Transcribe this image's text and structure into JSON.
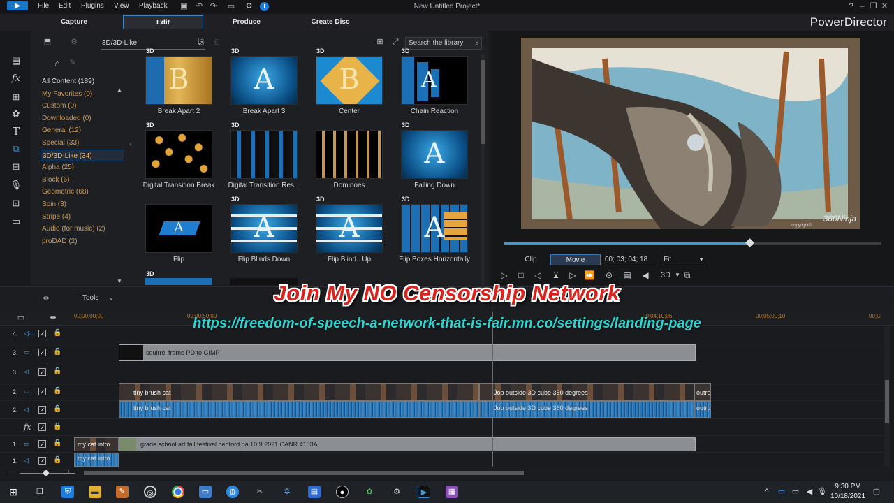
{
  "window": {
    "title": "New Untitled Project*",
    "brand": "PowerDirector"
  },
  "menu": [
    "File",
    "Edit",
    "Plugins",
    "View",
    "Playback"
  ],
  "modes": [
    "Capture",
    "Edit",
    "Produce",
    "Create Disc"
  ],
  "library": {
    "category_select": "3D/3D-Like",
    "search_placeholder": "Search the library",
    "categories": [
      "All Content  (189)",
      "My Favorites  (0)",
      "Custom  (0)",
      "Downloaded  (0)",
      "General  (12)",
      "Special  (33)",
      "3D/3D-Like  (34)",
      "Alpha  (25)",
      "Block  (6)",
      "Geometric  (68)",
      "Spin  (3)",
      "Stripe  (4)",
      "Audio (for music)  (2)",
      "proDAD  (2)"
    ],
    "items": [
      {
        "label": "Break Apart 2",
        "badge": "3D",
        "glyph": "B"
      },
      {
        "label": "Break Apart 3",
        "badge": "3D",
        "glyph": "A"
      },
      {
        "label": "Center",
        "badge": "3D",
        "glyph": "B"
      },
      {
        "label": "Chain Reaction",
        "badge": "3D",
        "glyph": "A"
      },
      {
        "label": "Digital Transition Break",
        "badge": "3D",
        "glyph": ""
      },
      {
        "label": "Digital Transition Res...",
        "badge": "3D",
        "glyph": ""
      },
      {
        "label": "Dominoes",
        "badge": "",
        "glyph": ""
      },
      {
        "label": "Falling Down",
        "badge": "3D",
        "glyph": "A"
      },
      {
        "label": "Flip",
        "badge": "",
        "glyph": "A"
      },
      {
        "label": "Flip Blinds Down",
        "badge": "3D",
        "glyph": "A"
      },
      {
        "label": "Flip Blind.. Up",
        "badge": "3D",
        "glyph": "A"
      },
      {
        "label": "Flip Boxes Horizontally",
        "badge": "3D",
        "glyph": "A"
      }
    ],
    "next_row_badge": "3D"
  },
  "preview": {
    "clip_tab": "Clip",
    "movie_tab": "Movie",
    "timecode": "00; 03; 04; 18",
    "fit": "Fit",
    "watermark": "360Ninja",
    "copyright": "copyright©",
    "mode_3d": "3D",
    "seek_fraction": 0.65
  },
  "overlay": {
    "title": "Join My NO Censorship Network",
    "url": "https://freedom-of-speech-a-network-that-is-fair.mn.co/settings/landing-page"
  },
  "timeline": {
    "tools_label": "Tools",
    "ruler": [
      "00;00;00;00",
      "00;00;50;00",
      "00;04;10;06",
      "00;05;00;10",
      "00;C"
    ],
    "tracks": [
      {
        "num": "4.",
        "clips": []
      },
      {
        "num": "3.",
        "clips": [
          "squirrel frame PD to GIMP"
        ]
      },
      {
        "num": "2.",
        "clips": [
          "tiny brush cat",
          "Job outside 3D cube 360 degrees",
          "outro"
        ]
      },
      {
        "num": "2.",
        "clips": [
          "tiny brush cat",
          "Job outside 3D cube 360 degrees",
          "outro"
        ]
      },
      {
        "num": "",
        "clips": []
      },
      {
        "num": "1.",
        "clips": [
          "my cat intro",
          "grade school art fall festival bedford pa 10 9 2021 CANR 4103A"
        ]
      },
      {
        "num": "1.",
        "clips": [
          "my cat intro"
        ]
      }
    ]
  },
  "taskbar": {
    "time": "9:30 PM",
    "date": "10/18/2021"
  },
  "colors": {
    "accent": "#3c88c8",
    "category": "#c99a55",
    "overlay_red": "#d9231c",
    "overlay_cyan": "#27d7d4",
    "playhead": "#d23b3b"
  }
}
